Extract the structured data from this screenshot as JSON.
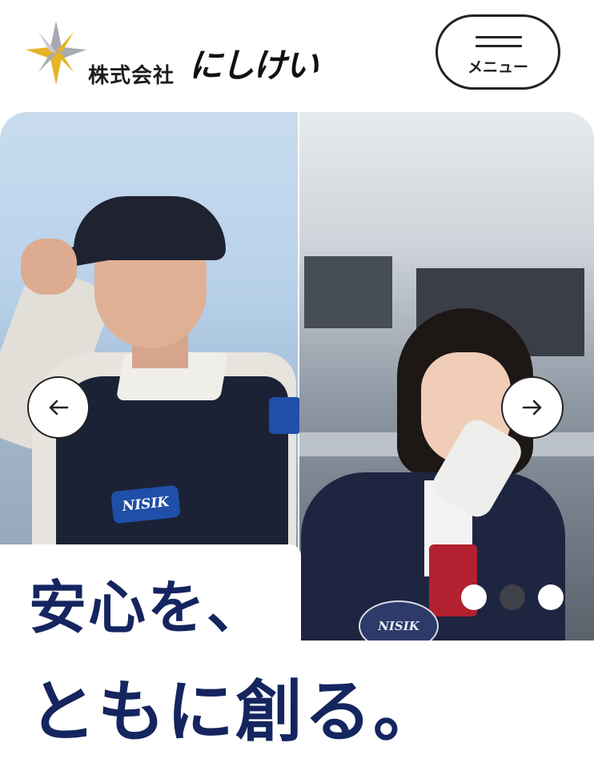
{
  "header": {
    "company_prefix": "株式会社",
    "brand_name": "にしけい",
    "logo_icon": "compass-star-icon",
    "menu_label": "メニュー",
    "menu_icon": "hamburger-icon"
  },
  "hero": {
    "left_patch_text": "NISIK",
    "right_emblem_text": "NISIK",
    "prev_icon": "arrow-left-icon",
    "next_icon": "arrow-right-icon",
    "slides_total": 3,
    "active_slide": 2
  },
  "headline": {
    "line1": "安心を、",
    "line2": "ともに創る。"
  },
  "colors": {
    "headline": "#15255f",
    "logo_gold": "#e5b325",
    "logo_silver": "#a7aab2",
    "dot_active": "#3e4148",
    "dot_inactive": "#ffffff"
  }
}
